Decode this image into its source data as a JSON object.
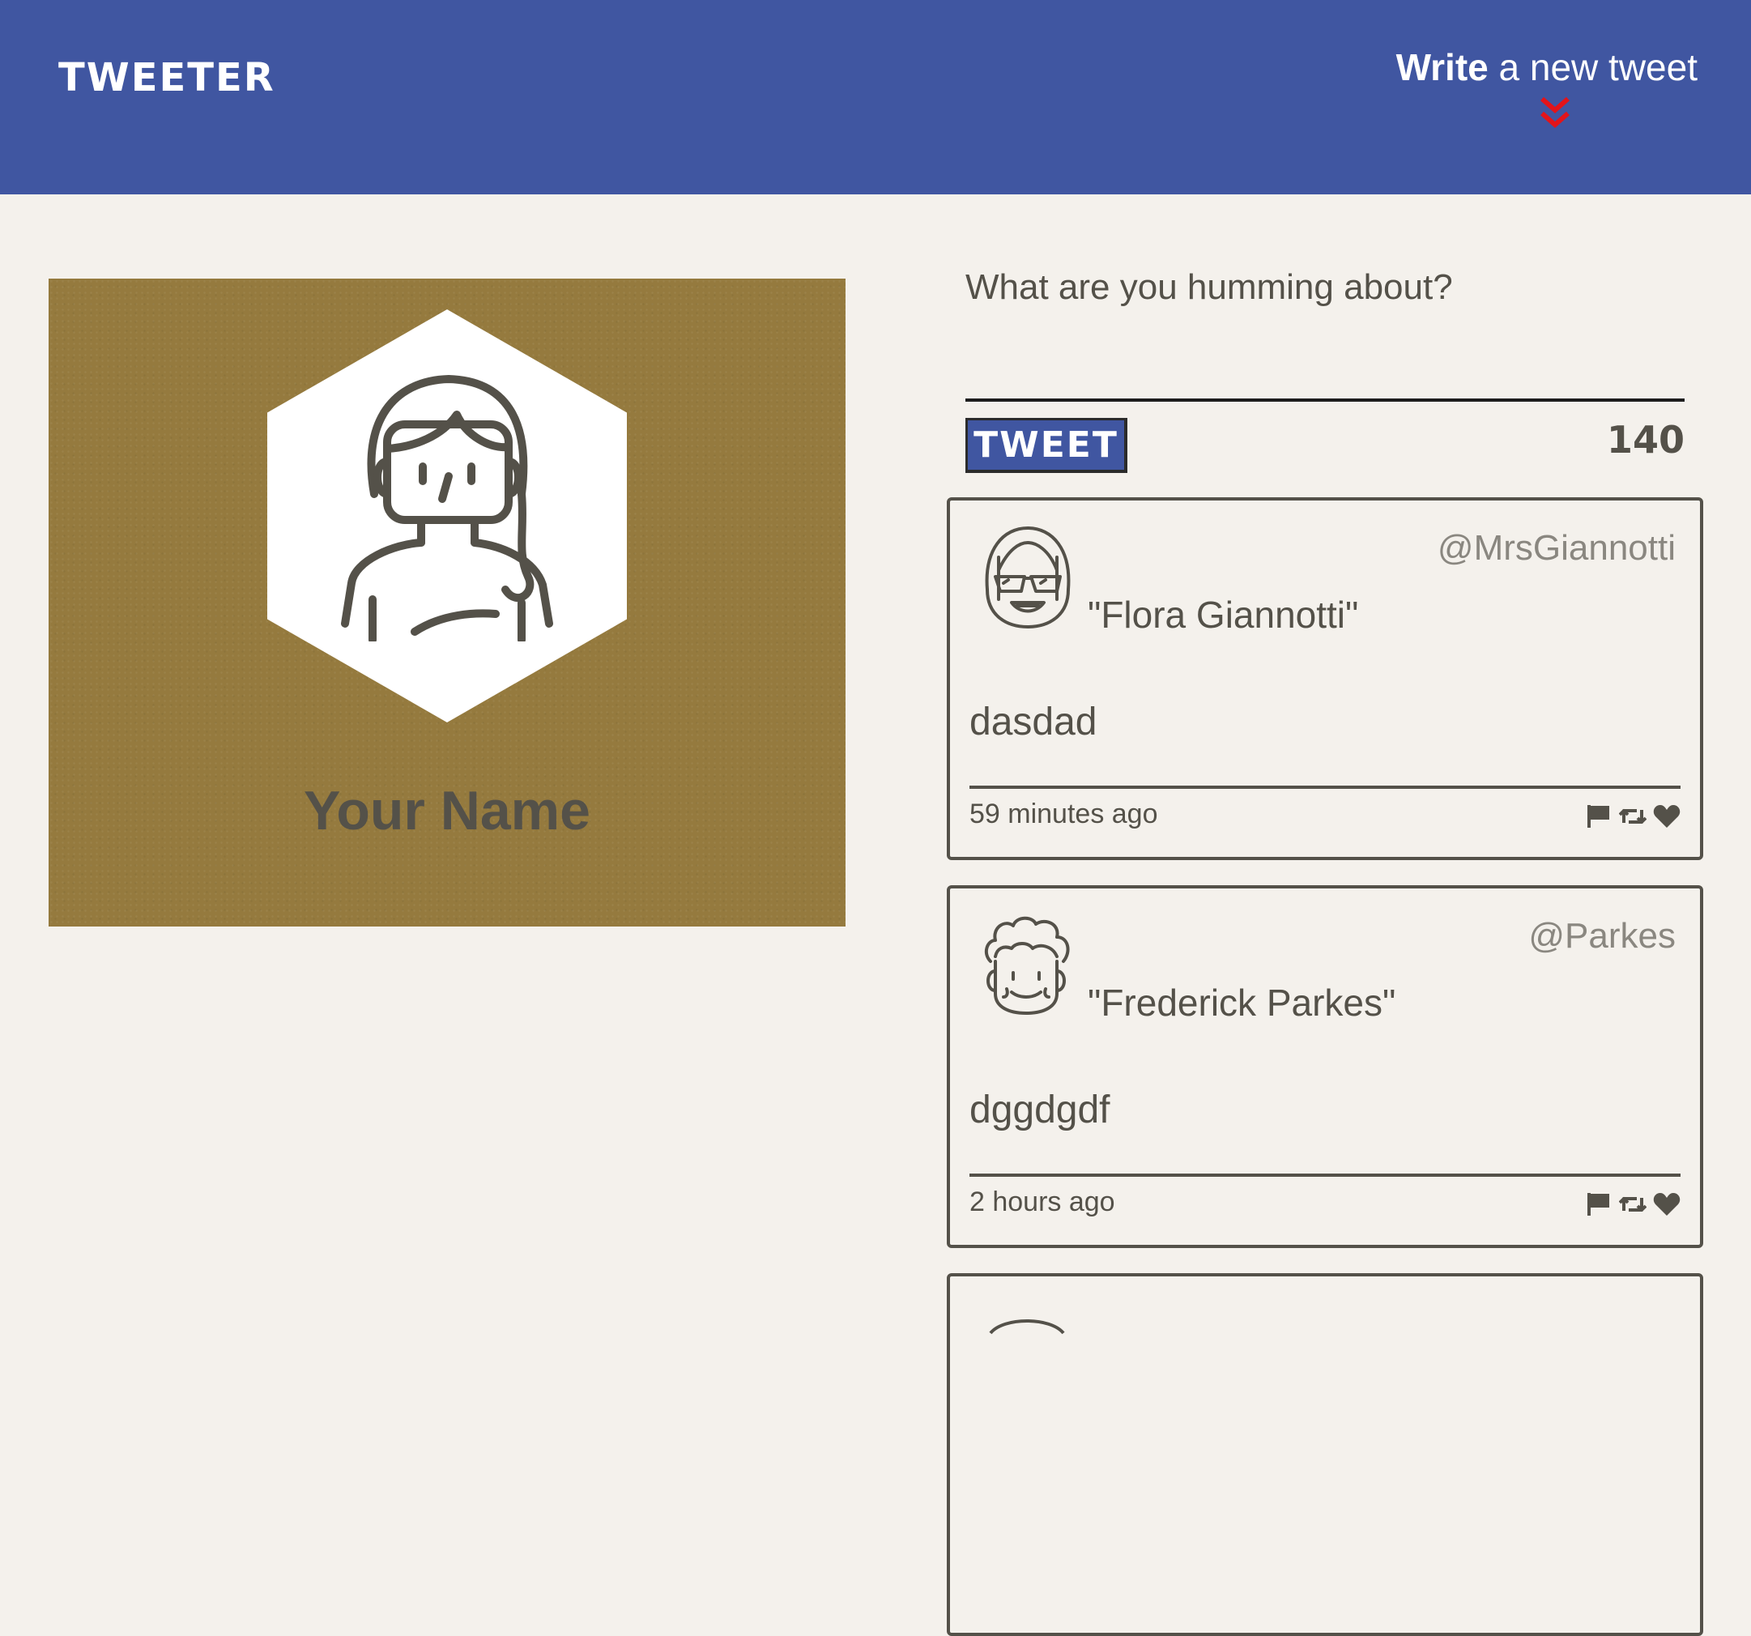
{
  "nav": {
    "logo": "TWEETER",
    "compose_strong": "Write",
    "compose_rest": " a new tweet",
    "compose_icon": "double-chevron-down-icon",
    "compose_icon_color": "#e3141a",
    "bg_color": "#4056a1"
  },
  "profile": {
    "name": "Your Name",
    "avatar_icon": "female-avatar-icon",
    "bg_color": "#957a3e"
  },
  "composer": {
    "placeholder": "What are you humming about?",
    "button_label": "TWEET",
    "counter": "140"
  },
  "tweets": [
    {
      "handle": "@MrsGiannotti",
      "name": "\"Flora Giannotti\"",
      "content": "dasdad",
      "time": "59 minutes ago",
      "avatar_icon": "avatar-glasses-icon"
    },
    {
      "handle": "@Parkes",
      "name": "\"Frederick Parkes\"",
      "content": "dggdgdf",
      "time": "2 hours ago",
      "avatar_icon": "avatar-curly-hair-icon"
    }
  ],
  "tweet_actions": [
    "flag-icon",
    "retweet-icon",
    "heart-icon"
  ],
  "colors": {
    "page_bg": "#f4f1ec",
    "text": "#545149",
    "button": "#4056a1"
  }
}
